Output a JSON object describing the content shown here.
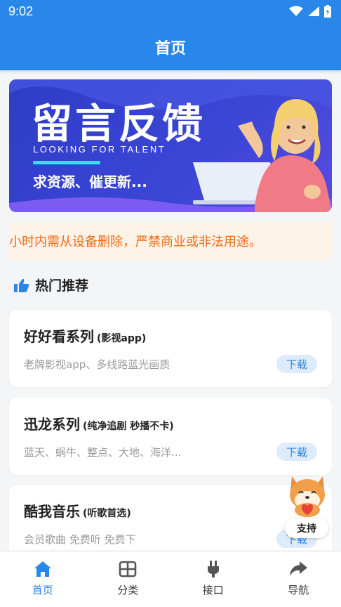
{
  "status_bar": {
    "time": "9:02"
  },
  "app_bar": {
    "title": "首页"
  },
  "banner": {
    "title": "留言反馈",
    "subtitle": "LOOKING FOR TALENT",
    "description": "求资源、催更新..."
  },
  "notice": {
    "text": "小时内需从设备删除，严禁商业或非法用途。"
  },
  "section": {
    "title": "热门推荐",
    "icon": "thumbs-up-icon"
  },
  "cards": [
    {
      "title": "好好看系列",
      "tag": "(影视app)",
      "desc": "老牌影视app、多线路蓝光画质",
      "button": "下载"
    },
    {
      "title": "迅龙系列",
      "tag": "(纯净追剧 秒播不卡)",
      "desc": "蓝天、蜗牛、整点、大地、海洋...",
      "button": "下载"
    },
    {
      "title": "酷我音乐",
      "tag": "(听歌首选)",
      "desc": "会员歌曲 免费听 免费下",
      "button": "下载"
    }
  ],
  "support": {
    "label": "支持"
  },
  "bottom_nav": [
    {
      "label": "首页",
      "icon": "home-icon",
      "active": true
    },
    {
      "label": "分类",
      "icon": "grid-icon",
      "active": false
    },
    {
      "label": "接口",
      "icon": "plug-icon",
      "active": false
    },
    {
      "label": "导航",
      "icon": "share-arrow-icon",
      "active": false
    }
  ],
  "colors": {
    "primary": "#2a87ea",
    "notice_text": "#f06a17",
    "notice_bg": "#fdf3e6",
    "banner_bg": "#3b46d6"
  }
}
